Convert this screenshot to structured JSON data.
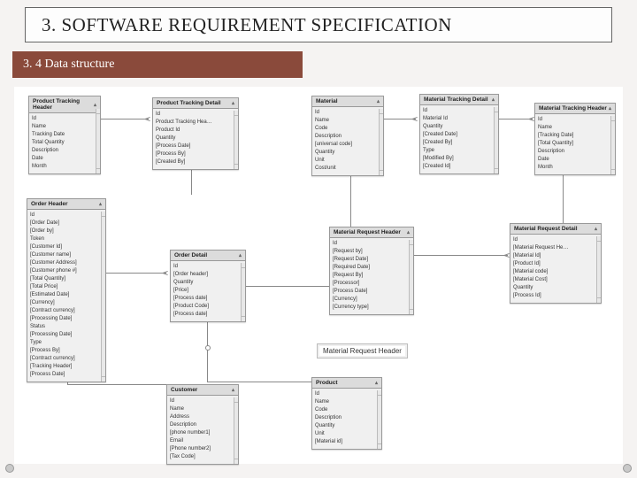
{
  "header": {
    "title": "3. SOFTWARE REQUIREMENT SPECIFICATION"
  },
  "subheader": {
    "text": "3. 4 Data structure"
  },
  "label_card": {
    "text": "Material Request Header"
  },
  "entities": {
    "prodTrackHeader": {
      "title": "Product Tracking Header",
      "fields": [
        "Id",
        "Name",
        "Tracking Date",
        "Total Quantity",
        "Description",
        "Date",
        "Month"
      ]
    },
    "prodTrackDetail": {
      "title": "Product Tracking Detail",
      "fields": [
        "Id",
        "Product Tracking Hea…",
        "Product Id",
        "Quantity",
        "[Process Date]",
        "[Process By]",
        "[Created By]"
      ]
    },
    "material": {
      "title": "Material",
      "fields": [
        "Id",
        "Name",
        "Code",
        "Description",
        "[universal code]",
        "Quantity",
        "Unit",
        "Cost/unit"
      ]
    },
    "matTrackDetail": {
      "title": "Material Tracking Detail",
      "fields": [
        "Id",
        "Material Id",
        "Quantity",
        "[Created Date]",
        "[Created By]",
        "Type",
        "[Modified By]",
        "[Created Id]"
      ]
    },
    "matTrackHeader": {
      "title": "Material Tracking Header",
      "fields": [
        "Id",
        "Name",
        "[Tracking Date]",
        "[Total Quantity]",
        "Description",
        "Date",
        "Month"
      ]
    },
    "orderHeader": {
      "title": "Order Header",
      "fields": [
        "Id",
        "[Order Date]",
        "[Order by]",
        "Token",
        "[Customer Id]",
        "[Customer name]",
        "[Customer Address]",
        "[Customer phone #]",
        "[Total Quantity]",
        "[Total Price]",
        "[Estimated Date]",
        "[Currency]",
        "[Contract currency]",
        "[Processing Date]",
        "Status",
        "[Processing Date]",
        "Type",
        "[Process By]",
        "[Contract currency]",
        "[Tracking Header]",
        "[Process Date]"
      ]
    },
    "orderDetail": {
      "title": "Order Detail",
      "fields": [
        "Id",
        "[Order header]",
        "Quantity",
        "[Price]",
        "[Process date]",
        "[Product Code]",
        "[Process date]"
      ]
    },
    "matReqHeader": {
      "title": "Material Request Header",
      "fields": [
        "Id",
        "[Request by]",
        "[Request Date]",
        "[Required Date]",
        "[Request By]",
        "[Processor]",
        "[Process Date]",
        "[Currency]",
        "[Currency type]"
      ]
    },
    "matReqDetail": {
      "title": "Material Request Detail",
      "fields": [
        "Id",
        "[Material Request He…",
        "[Material Id]",
        "[Product Id]",
        "[Material code]",
        "[Material Cost]",
        "Quantity",
        "[Process Id]"
      ]
    },
    "customer": {
      "title": "Customer",
      "fields": [
        "Id",
        "Name",
        "Address",
        "Description",
        "[phone number1]",
        "Email",
        "[Phone number2]",
        "[Tax Code]"
      ]
    },
    "product": {
      "title": "Product",
      "fields": [
        "Id",
        "Name",
        "Code",
        "Description",
        "Quantity",
        "Unit",
        "[Material id]"
      ]
    }
  }
}
